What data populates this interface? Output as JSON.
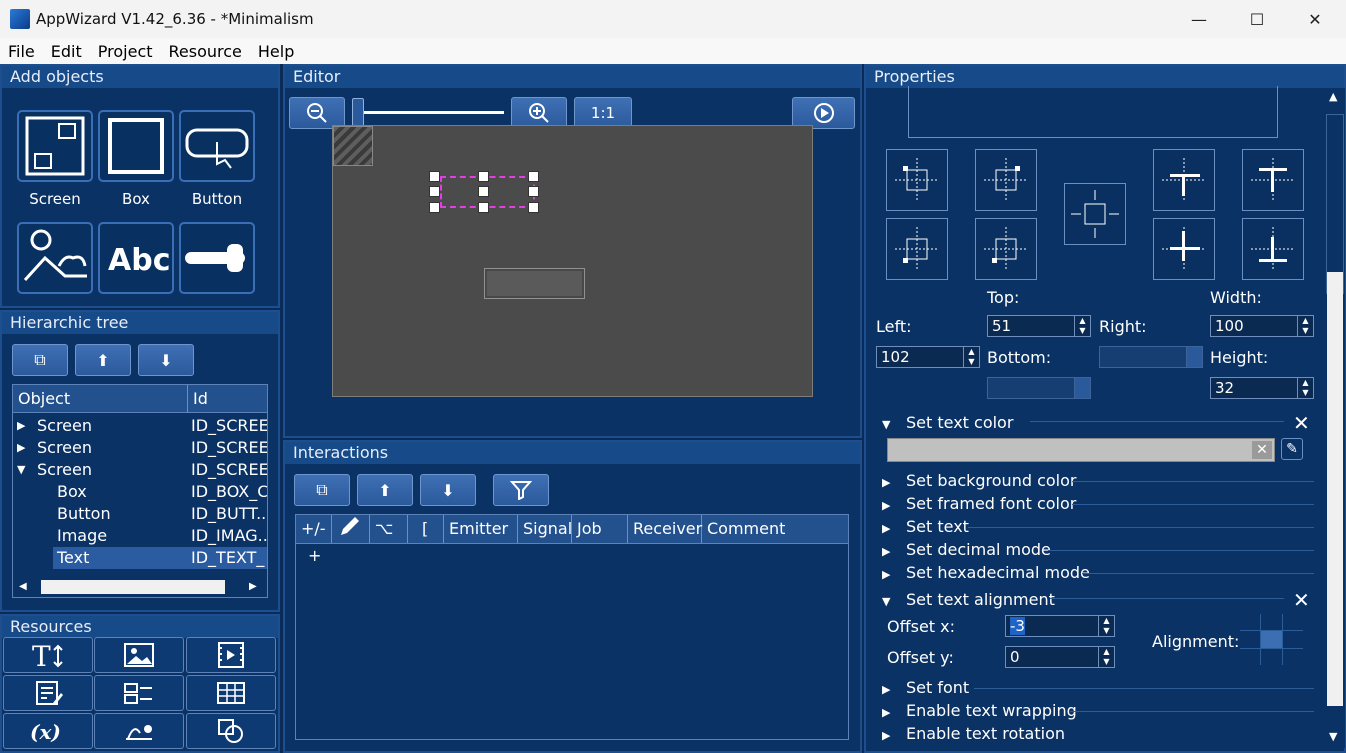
{
  "window": {
    "title": "AppWizard V1.42_6.36 - *Minimalism",
    "minimize": "—",
    "maximize": "☐",
    "close": "✕"
  },
  "menu": [
    "File",
    "Edit",
    "Project",
    "Resource",
    "Help"
  ],
  "add_objects": {
    "title": "Add objects",
    "items": [
      "Screen",
      "Box",
      "Button",
      "",
      "",
      ""
    ]
  },
  "tree": {
    "title": "Hierarchic tree",
    "columns": [
      "Object",
      "Id"
    ],
    "rows": [
      {
        "object": "Screen",
        "id": "ID_SCREE",
        "expander": "▶"
      },
      {
        "object": "Screen",
        "id": "ID_SCREE",
        "expander": "▶"
      },
      {
        "object": "Screen",
        "id": "ID_SCREE",
        "expander": "▼"
      },
      {
        "object": "Box",
        "id": "ID_BOX_C",
        "expander": ""
      },
      {
        "object": "Button",
        "id": "ID_BUTT..",
        "expander": ""
      },
      {
        "object": "Image",
        "id": "ID_IMAG..",
        "expander": ""
      },
      {
        "object": "Text",
        "id": "ID_TEXT_",
        "expander": "",
        "selected": true
      }
    ]
  },
  "resources": {
    "title": "Resources"
  },
  "editor": {
    "title": "Editor",
    "zoom_label": "1:1"
  },
  "interactions": {
    "title": "Interactions",
    "columns": [
      "+/-",
      "",
      "⌥",
      "[",
      "Emitter",
      "Signal",
      "Job",
      "Receiver",
      "Comment"
    ],
    "add_row": "+"
  },
  "properties": {
    "title": "Properties",
    "top_label": "Top:",
    "width_label": "Width:",
    "left_label": "Left:",
    "right_label": "Right:",
    "bottom_label": "Bottom:",
    "height_label": "Height:",
    "top": "51",
    "width": "100",
    "left": "102",
    "right": "",
    "bottom": "",
    "height": "32",
    "sections": [
      "Set text color",
      "Set background color",
      "Set framed font color",
      "Set text",
      "Set decimal mode",
      "Set hexadecimal mode",
      "Set text alignment",
      "Set font",
      "Enable text wrapping",
      "Enable text rotation"
    ],
    "offset_x_label": "Offset x:",
    "offset_y_label": "Offset y:",
    "offset_x": "-3",
    "offset_y": "0",
    "alignment_label": "Alignment:"
  },
  "colors": {
    "accent": "#164a88",
    "panel": "#0b3264",
    "selection": "#e040e0"
  }
}
